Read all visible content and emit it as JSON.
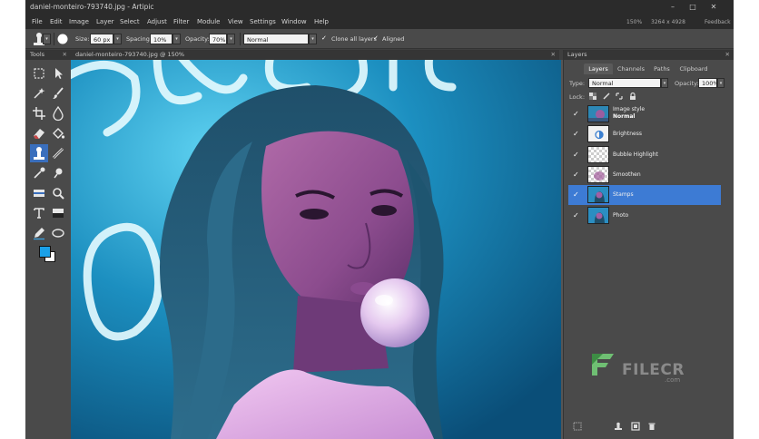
{
  "window": {
    "title": "daniel-monteiro-793740.jpg - Artipic",
    "zoom": "150%",
    "dimensions": "3264 x 4928",
    "feedback": "Feedback"
  },
  "menu": [
    "File",
    "Edit",
    "Image",
    "Layer",
    "Select",
    "Adjust",
    "Filter",
    "Module",
    "View",
    "Settings",
    "Window",
    "Help"
  ],
  "options": {
    "size_label": "Size:",
    "size_value": "60 px",
    "spacing_label": "Spacing:",
    "spacing_value": "10%",
    "opacity_label": "Opacity:",
    "opacity_value": "70%",
    "blend_mode": "Normal",
    "clone_all_layers": "Clone all layers",
    "aligned": "Aligned"
  },
  "tools_panel": {
    "title": "Tools"
  },
  "document": {
    "tab_title": "daniel-monteiro-793740.jpg @ 150%"
  },
  "layers_panel": {
    "title": "Layers",
    "tabs": [
      "Layers",
      "Channels",
      "Paths",
      "Clipboard"
    ],
    "type_label": "Type:",
    "type_value": "Normal",
    "opacity_label": "Opacity:",
    "opacity_value": "100%",
    "lock_label": "Lock:",
    "layers": [
      {
        "name": "Image style",
        "sub": "Normal",
        "selected": false
      },
      {
        "name": "Brightness",
        "selected": false
      },
      {
        "name": "Bubble Highlight",
        "selected": false
      },
      {
        "name": "Smoothen",
        "selected": false
      },
      {
        "name": "Stamps",
        "selected": true
      },
      {
        "name": "Photo",
        "selected": false
      }
    ]
  },
  "watermark": {
    "text": "FILECR",
    "sub": ".com"
  },
  "colors": {
    "accent": "#3d7bd4",
    "foreground": "#1aa0e8",
    "background": "#ffffff"
  }
}
